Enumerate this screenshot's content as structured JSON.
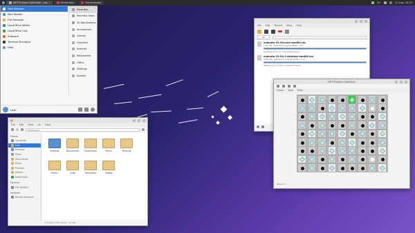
{
  "panel": {
    "tasks": [
      "NET Puzzles Collection - Ins...",
      "Terminator",
      "Transmission"
    ],
    "tray": {
      "volume": "6+",
      "date": "22 Aug, 20:03"
    }
  },
  "menu": {
    "apps": [
      "Web Browser",
      "Mail Reader",
      "File Manager",
      "LibreOffice Writer",
      "LibreOffice Calc",
      "Software",
      "Terminal Emulator",
      "Help"
    ],
    "categories": [
      "Favorites",
      "Recently Used",
      "All Applications",
      "Accessories",
      "Games",
      "Graphics",
      "Internet",
      "Multimedia",
      "Office",
      "Settings",
      "System"
    ],
    "user": "User",
    "search_placeholder": ""
  },
  "filemanager": {
    "menus": [
      "File",
      "Edit",
      "View",
      "Go",
      "Help"
    ],
    "path": "/home/user",
    "places_head": "Places",
    "places": [
      "Computer",
      "User",
      "Desktop",
      "Trash",
      "Documents",
      "Music",
      "Pictures",
      "Videos",
      "Downloads"
    ],
    "devices_head": "Devices",
    "devices": [
      "File System"
    ],
    "network_head": "Network",
    "network": [
      "Browse Network"
    ],
    "folders": [
      "Desktop",
      "Documents",
      "Downloads",
      "Music",
      "Pictures",
      "Public",
      "snap",
      "Templates",
      "Videos"
    ],
    "status": "9 folders, Free space: 7.6 GiB"
  },
  "transmission": {
    "menus": [
      "File",
      "Edit",
      "Torrent",
      "View",
      "Help"
    ],
    "count": "All",
    "torrents": [
      {
        "name": "xubuntu-22.04-core-amd64.iso",
        "info": "1.04 GB, uploaded 0 bytes (Ratio: 0.0)",
        "status": "Seeding to 0 of 7 connected peers",
        "progress": 1.0
      },
      {
        "name": "xubuntu-22.04.1-desktop-amd64.iso",
        "info": "2.66 GB, uploaded 13.79 kB (Ratio: 0.0)",
        "status": "Seeding to 0 of 18 connected peers",
        "progress": 1.0
      }
    ]
  },
  "puzzle": {
    "title": "NET Puzzles Collection",
    "menus": [
      "Game",
      "Type",
      "Help"
    ],
    "status": "Moves: 0"
  },
  "colors": {
    "accent": "#2f7ad8",
    "panel": "#2b2b2b"
  }
}
